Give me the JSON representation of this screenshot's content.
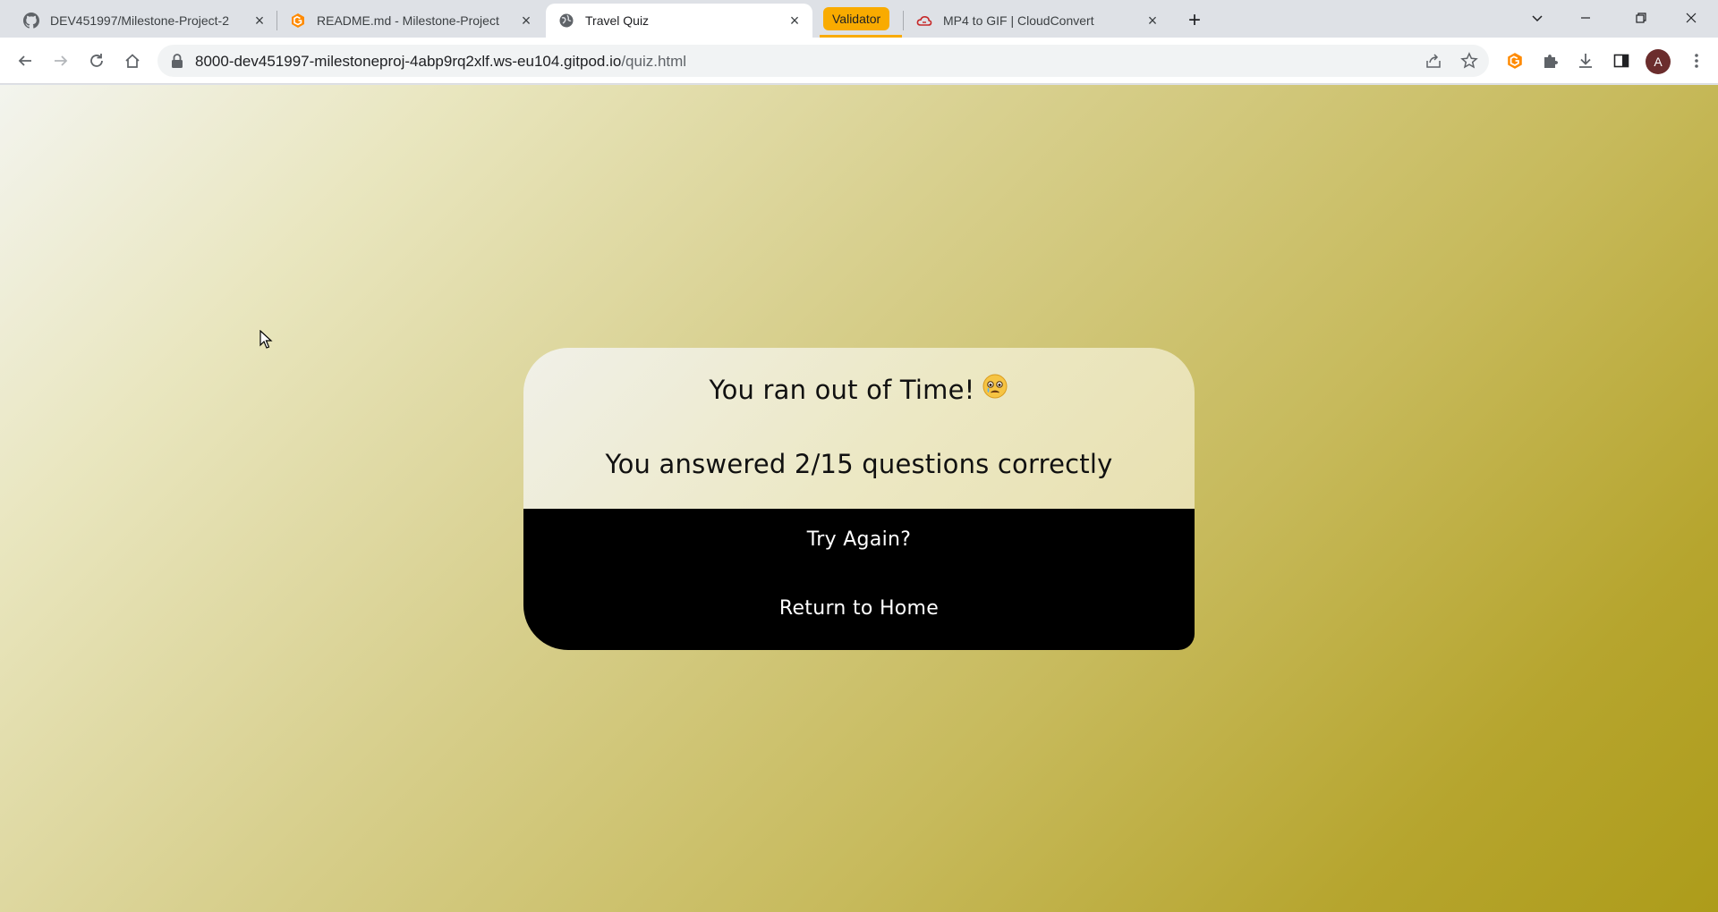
{
  "tabs": [
    {
      "title": "DEV451997/Milestone-Project-2",
      "favicon": "github-icon"
    },
    {
      "title": "README.md - Milestone-Project",
      "favicon": "gitpod-icon"
    },
    {
      "title": "Travel Quiz",
      "favicon": "globe-icon",
      "active": true
    },
    {
      "title": "MP4 to GIF | CloudConvert",
      "favicon": "cloudconvert-icon"
    }
  ],
  "tab_group": {
    "label": "Validator",
    "color": "#f9ab00"
  },
  "address_bar": {
    "host": "8000-dev451997-milestoneproj-4abp9rq2xlf.ws-eu104.gitpod.io",
    "path": "/quiz.html"
  },
  "profile": {
    "initial": "A"
  },
  "result_card": {
    "message": "You ran out of Time!",
    "score_text": "You answered 2/15 questions correctly",
    "try_again_label": "Try Again?",
    "home_label": "Return to Home"
  },
  "colors": {
    "accent": "#f9ab00",
    "card_bottom": "#000000",
    "page_gradient_end": "#ad9c1a"
  }
}
